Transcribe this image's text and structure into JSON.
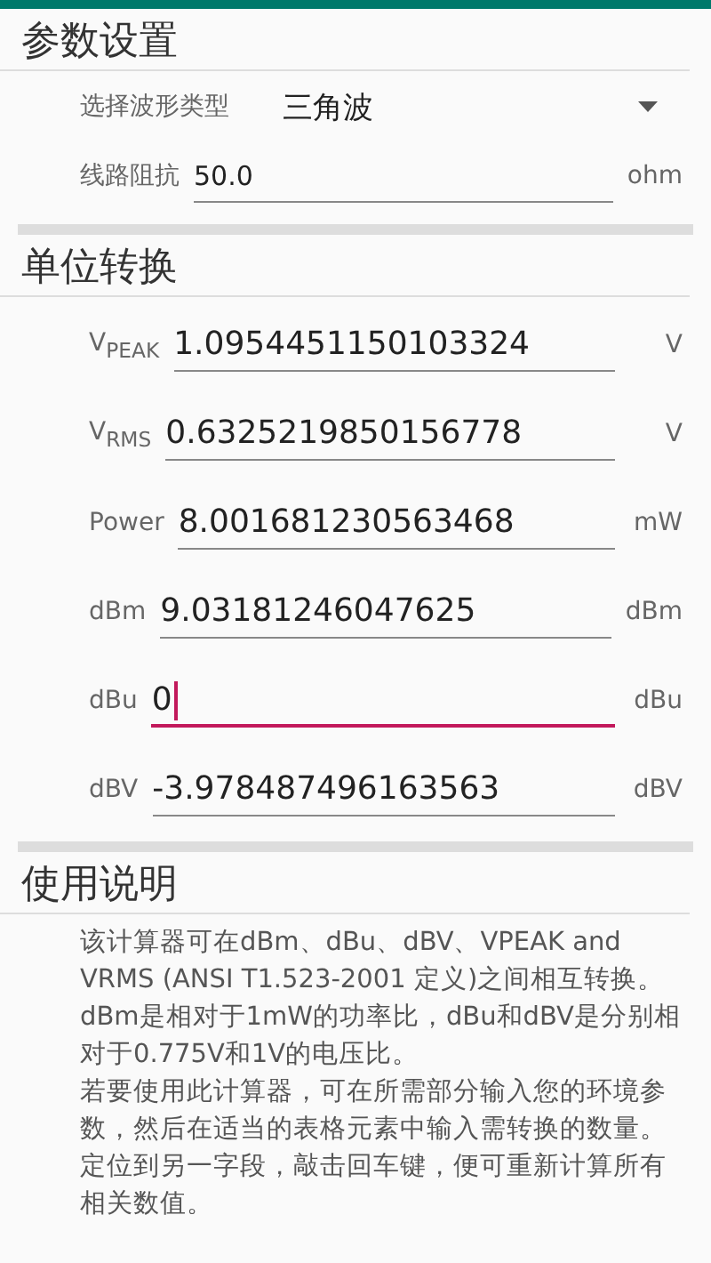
{
  "params": {
    "title": "参数设置",
    "waveform": {
      "label": "选择波形类型",
      "value": "三角波"
    },
    "impedance": {
      "label": "线路阻抗",
      "value": "50.0",
      "unit": "ohm"
    }
  },
  "conversion": {
    "title": "单位转换",
    "rows": [
      {
        "label": "V$_{PEAK}$",
        "value": "1.0954451150103324",
        "unit": "V",
        "focused": false
      },
      {
        "label": "V$_{RMS}$",
        "value": "0.6325219850156778",
        "unit": "V",
        "focused": false
      },
      {
        "label": "Power",
        "value": "8.001681230563468",
        "unit": "mW",
        "focused": false
      },
      {
        "label": "dBm",
        "value": "9.03181246047625",
        "unit": "dBm",
        "focused": false
      },
      {
        "label": "dBu",
        "value": "0",
        "unit": "dBu",
        "focused": true
      },
      {
        "label": "dBV",
        "value": "-3.978487496163563",
        "unit": "dBV",
        "focused": false
      }
    ]
  },
  "help": {
    "title": "使用说明",
    "paragraphs": [
      "该计算器可在dBm、dBu、dBV、VPEAK and VRMS (ANSI T1.523-2001 定义)之间相互转换。",
      "dBm是相对于1mW的功率比，dBu和dBV是分别相对于0.775V和1V的电压比。",
      "若要使用此计算器，可在所需部分输入您的环境参数，然后在适当的表格元素中输入需转换的数量。",
      "定位到另一字段，敲击回车键，便可重新计算所有相关数值。"
    ]
  }
}
